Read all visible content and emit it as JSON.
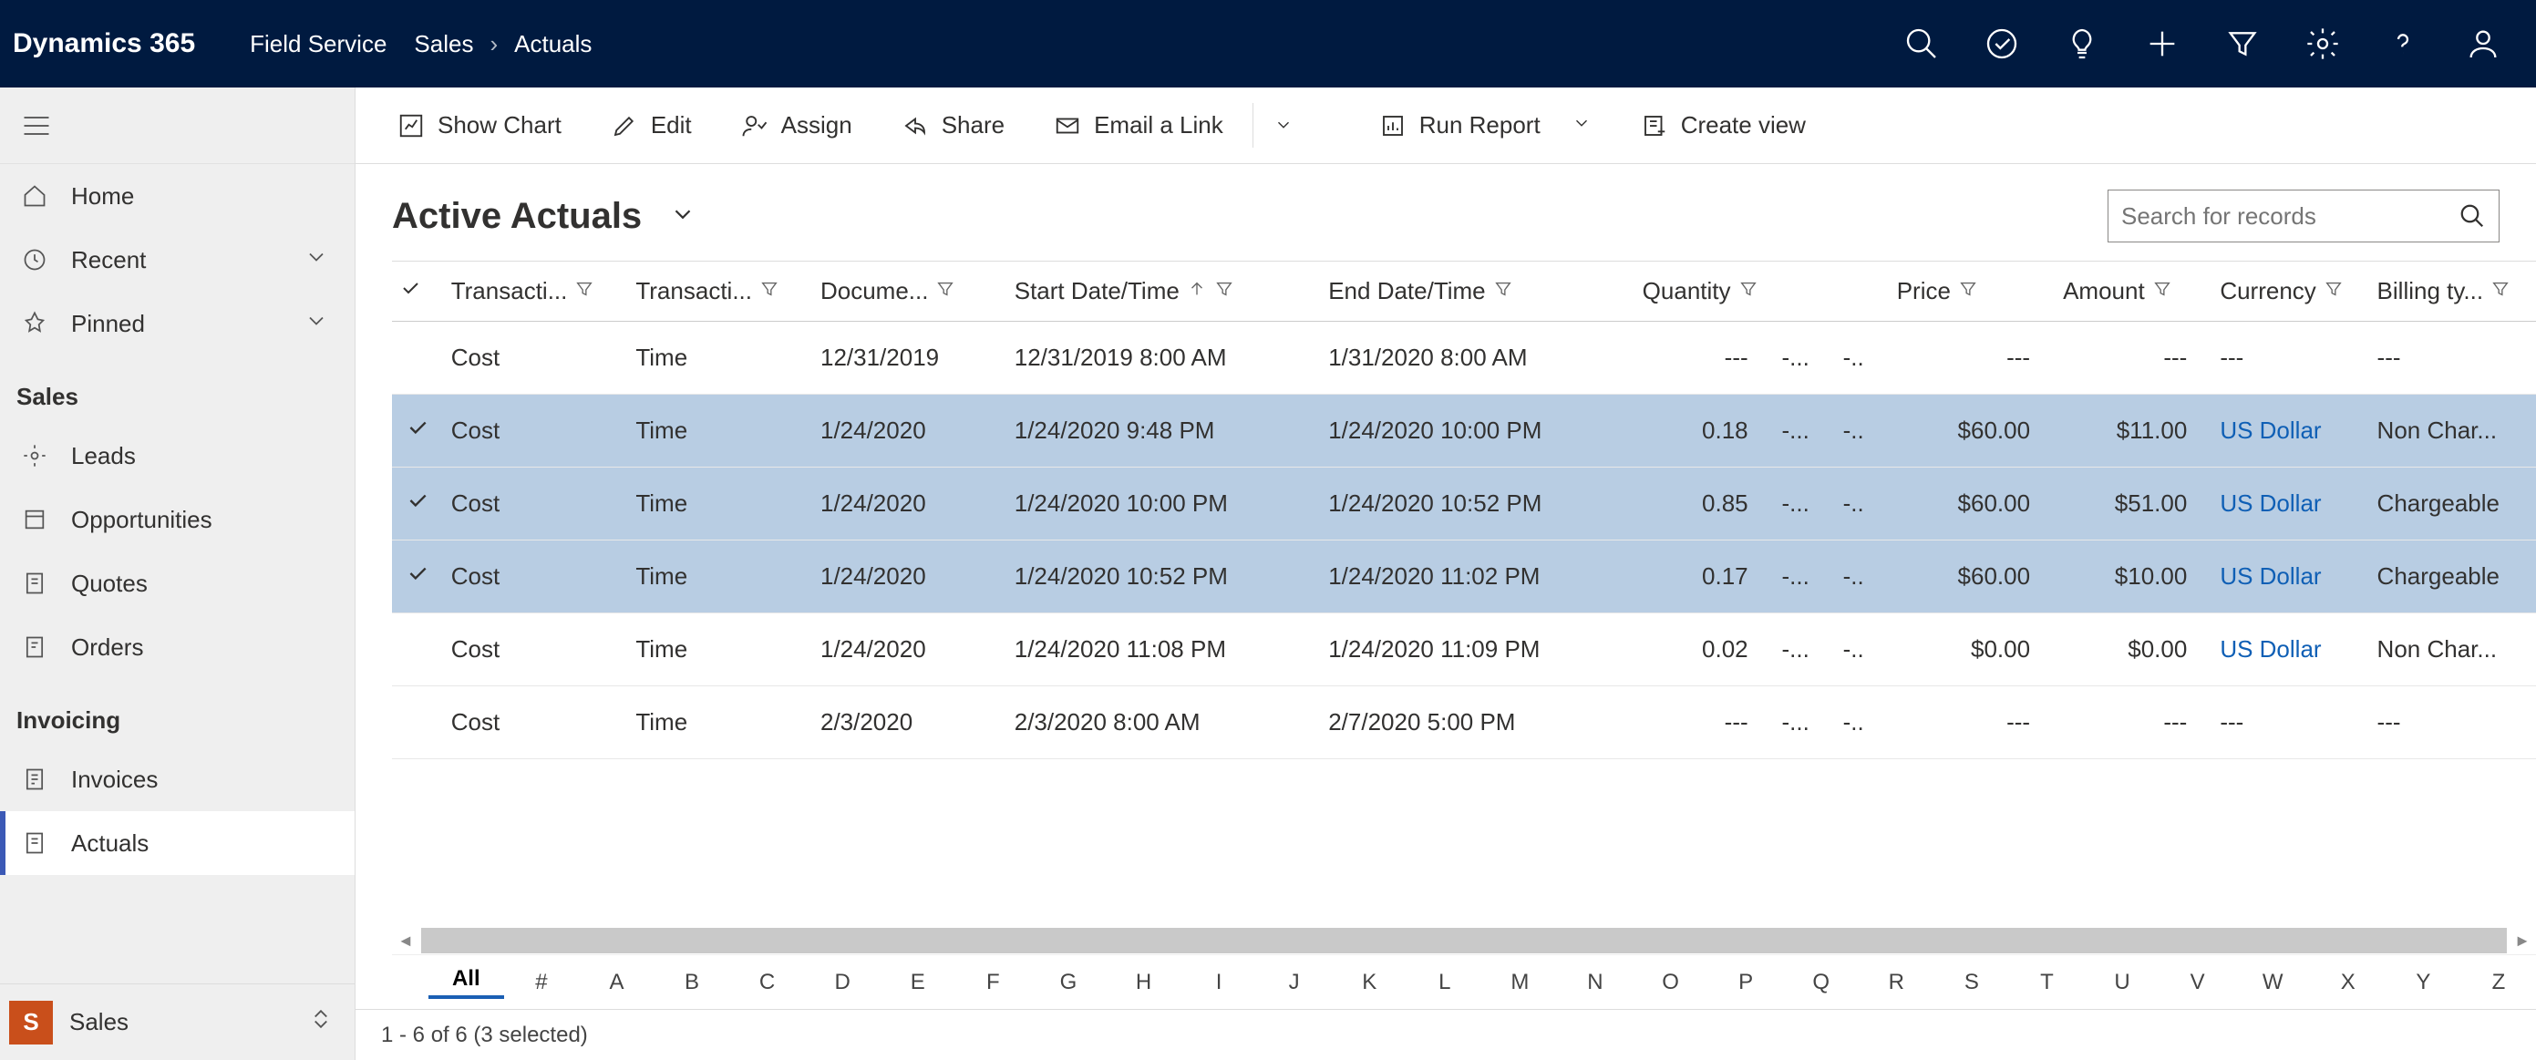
{
  "topbar": {
    "brand": "Dynamics 365",
    "module": "Field Service",
    "breadcrumb": [
      "Sales",
      "Actuals"
    ]
  },
  "sidebar": {
    "nav": [
      {
        "icon": "home",
        "label": "Home"
      },
      {
        "icon": "clock",
        "label": "Recent",
        "expand": true
      },
      {
        "icon": "pin",
        "label": "Pinned",
        "expand": true
      }
    ],
    "groups": [
      {
        "title": "Sales",
        "items": [
          {
            "icon": "leads",
            "label": "Leads"
          },
          {
            "icon": "opps",
            "label": "Opportunities"
          },
          {
            "icon": "quotes",
            "label": "Quotes"
          },
          {
            "icon": "orders",
            "label": "Orders"
          }
        ]
      },
      {
        "title": "Invoicing",
        "items": [
          {
            "icon": "inv",
            "label": "Invoices"
          },
          {
            "icon": "act",
            "label": "Actuals",
            "active": true
          }
        ]
      }
    ],
    "footer": {
      "badge": "S",
      "label": "Sales"
    }
  },
  "commands": {
    "show_chart": "Show Chart",
    "edit": "Edit",
    "assign": "Assign",
    "share": "Share",
    "email": "Email a Link",
    "run_report": "Run Report",
    "create_view": "Create view"
  },
  "view": {
    "title": "Active Actuals",
    "search_placeholder": "Search for records"
  },
  "columns": [
    "Transacti...",
    "Transacti...",
    "Docume...",
    "Start Date/Time",
    "End Date/Time",
    "Quantity",
    "",
    "",
    "Price",
    "Amount",
    "Currency",
    "Billing ty..."
  ],
  "rows": [
    {
      "sel": false,
      "c": [
        "Cost",
        "Time",
        "12/31/2019",
        "12/31/2019 8:00 AM",
        "1/31/2020 8:00 AM",
        "---",
        "-...",
        "-..",
        "---",
        "---",
        "---",
        "---"
      ]
    },
    {
      "sel": true,
      "c": [
        "Cost",
        "Time",
        "1/24/2020",
        "1/24/2020 9:48 PM",
        "1/24/2020 10:00 PM",
        "0.18",
        "-...",
        "-..",
        "$60.00",
        "$11.00",
        "US Dollar",
        "Non Char..."
      ]
    },
    {
      "sel": true,
      "c": [
        "Cost",
        "Time",
        "1/24/2020",
        "1/24/2020 10:00 PM",
        "1/24/2020 10:52 PM",
        "0.85",
        "-...",
        "-..",
        "$60.00",
        "$51.00",
        "US Dollar",
        "Chargeable"
      ]
    },
    {
      "sel": true,
      "c": [
        "Cost",
        "Time",
        "1/24/2020",
        "1/24/2020 10:52 PM",
        "1/24/2020 11:02 PM",
        "0.17",
        "-...",
        "-..",
        "$60.00",
        "$10.00",
        "US Dollar",
        "Chargeable"
      ]
    },
    {
      "sel": false,
      "c": [
        "Cost",
        "Time",
        "1/24/2020",
        "1/24/2020 11:08 PM",
        "1/24/2020 11:09 PM",
        "0.02",
        "-...",
        "-..",
        "$0.00",
        "$0.00",
        "US Dollar",
        "Non Char..."
      ]
    },
    {
      "sel": false,
      "c": [
        "Cost",
        "Time",
        "2/3/2020",
        "2/3/2020 8:00 AM",
        "2/7/2020 5:00 PM",
        "---",
        "-...",
        "-..",
        "---",
        "---",
        "---",
        "---"
      ]
    }
  ],
  "az": [
    "All",
    "#",
    "A",
    "B",
    "C",
    "D",
    "E",
    "F",
    "G",
    "H",
    "I",
    "J",
    "K",
    "L",
    "M",
    "N",
    "O",
    "P",
    "Q",
    "R",
    "S",
    "T",
    "U",
    "V",
    "W",
    "X",
    "Y",
    "Z"
  ],
  "status": "1 - 6 of 6 (3 selected)"
}
